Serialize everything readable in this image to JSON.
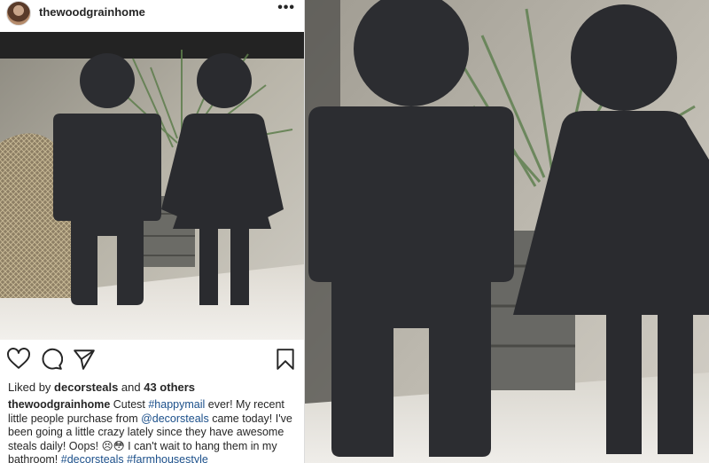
{
  "post": {
    "username": "thewoodgrainhome",
    "more_label": "•••",
    "likes": {
      "prefix": "Liked by ",
      "liker": "decorsteals",
      "middle": " and ",
      "count": "43 others"
    },
    "caption": {
      "username": "thewoodgrainhome",
      "seg1": " Cutest ",
      "tag1": "#happymail",
      "seg2": " ever! My recent little people purchase from ",
      "mention": "@decorsteals",
      "seg3": " came today! I've been going a little crazy lately since they have awesome steals daily! Oops! 😣😳 I can't wait to hang them in my bathroom! ",
      "tag2": "#decorsteals",
      "seg4": " ",
      "tag3": "#farmhousestyle"
    },
    "icons": [
      "heart-icon",
      "comment-icon",
      "share-icon",
      "bookmark-icon"
    ]
  },
  "colors": {
    "text": "#262626",
    "link": "#1b4f8a",
    "figure": "#2c2d31"
  }
}
